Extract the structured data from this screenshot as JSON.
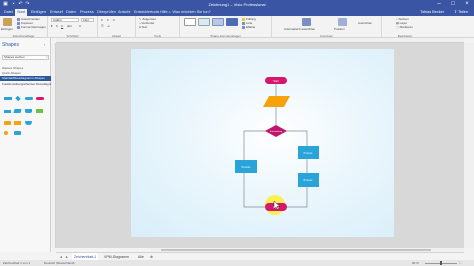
{
  "titlebar": {
    "title": "Zeichnung1 – Visio Professional"
  },
  "ribbon_tabs": [
    {
      "label": "Datei"
    },
    {
      "label": "Start"
    },
    {
      "label": "Einfügen"
    },
    {
      "label": "Entwurf"
    },
    {
      "label": "Daten"
    },
    {
      "label": "Prozess"
    },
    {
      "label": "Überprüfen"
    },
    {
      "label": "Ansicht"
    },
    {
      "label": "Entwicklertools"
    },
    {
      "label": "Hilfe"
    }
  ],
  "tellme": "Was möchten Sie tun?",
  "user": "Tobias Becker",
  "share": "Teilen",
  "ribbon": {
    "clipboard": {
      "paste": "Einfügen",
      "cut": "Ausschneiden",
      "copy": "Kopieren",
      "format": "Format übertragen",
      "label": "Zwischenablage"
    },
    "font": {
      "name": "Calibri",
      "size": "12pt.",
      "label": "Schriftart"
    },
    "paragraph": {
      "label": "Absatz"
    },
    "tools": {
      "pointer": "Zeigertool",
      "connector": "Verbinder",
      "text": "Text",
      "label": "Tools"
    },
    "shape_styles": {
      "label": "Shape-Formatvorlagen"
    },
    "arrange": {
      "position": "Position",
      "align": "Ausrichten",
      "label": "Anordnen"
    },
    "find": {
      "search": "Suchen",
      "layers": "Layer",
      "select": "Markieren",
      "label": "Bearbeiten"
    },
    "extra": {
      "fill": "Füllung",
      "line": "Linie",
      "effects": "Effekte",
      "auto_align": "Automatisch ausrichten"
    }
  },
  "shapes_pane": {
    "title": "Shapes",
    "search_placeholder": "Shapes suchen",
    "more_shapes": "Weitere Shapes",
    "quick_shapes": "Quick-Shapes",
    "stencils": [
      {
        "label": "Standardflussdiagramm-Shapes"
      },
      {
        "label": "Funktionsübergreifendes Flussdiagramm"
      }
    ]
  },
  "diagram": {
    "start_label": "Start",
    "nodes": [
      {
        "label": "Prozess"
      },
      {
        "label": "Prozess"
      },
      {
        "label": "Prozess"
      }
    ],
    "decision_label": "Entscheidung",
    "end_label": "Ende",
    "colors": {
      "terminator": "#d6176c",
      "input": "#f6a20c",
      "decision": "#c2166d",
      "process": "#29a4d8",
      "connector": "#7f8c99",
      "cursor_highlight": "#ffee33"
    }
  },
  "page_tabs": [
    {
      "label": "Zeichenblatt-1"
    },
    {
      "label": "VPM-Diagramm"
    },
    {
      "label": "Alle"
    }
  ],
  "statusbar": {
    "page": "Zeichenblatt 1 von 1",
    "language": "Deutsch (Deutschland)",
    "zoom": "90 %"
  }
}
